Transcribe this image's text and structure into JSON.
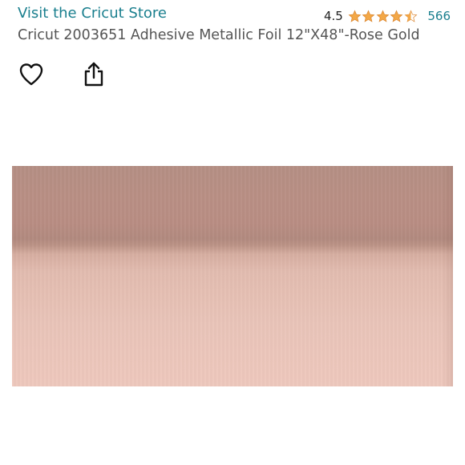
{
  "store": {
    "link_text": "Visit the Cricut Store"
  },
  "rating": {
    "value": "4.5",
    "stars": 4.5,
    "review_count": "566",
    "star_color": "#f3a847"
  },
  "product": {
    "title": "Cricut 2003651 Adhesive Metallic Foil 12\"X48\"-Rose Gold",
    "image_colors": [
      "#b58f84",
      "#e6c0b4"
    ]
  },
  "actions": {
    "icons": [
      "heart-icon",
      "share-icon"
    ]
  },
  "colors": {
    "link": "#1a7f8e",
    "title_text": "#555555"
  }
}
